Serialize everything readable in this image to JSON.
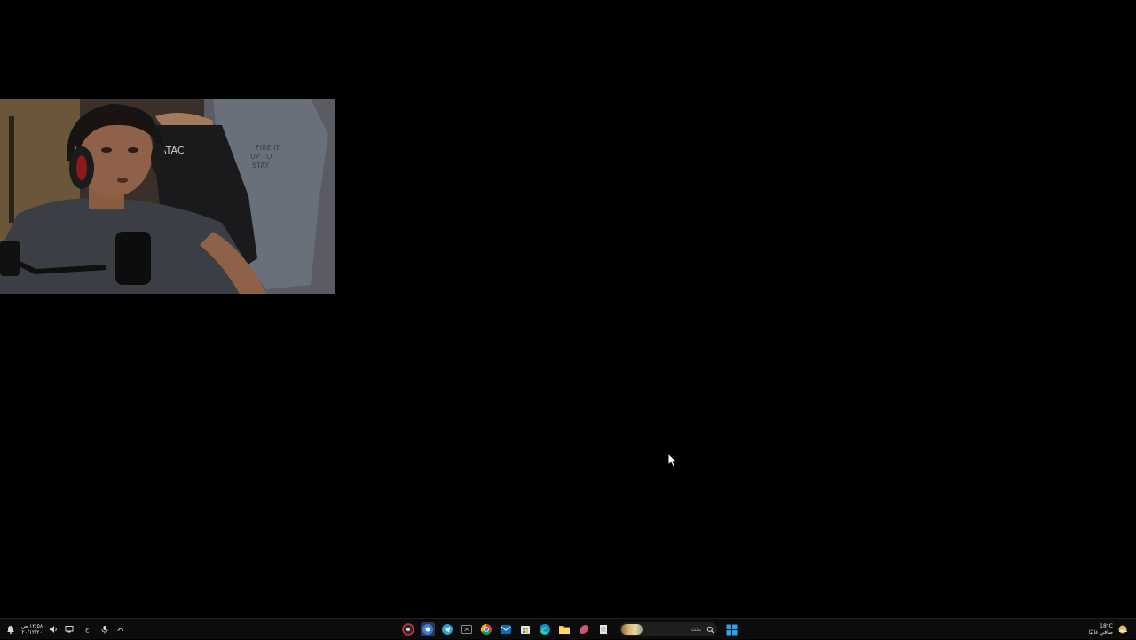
{
  "desktop": {
    "background": "#000000"
  },
  "webcam": {
    "shirt_text": "ATAC"
  },
  "taskbar": {
    "clock": {
      "time": "١٢:٥٨ ص",
      "date": "٢٠/١٢/٢٠"
    },
    "language": "ع",
    "tray_icons": [
      "notification-bell-icon",
      "volume-icon",
      "network-icon",
      "microphone-icon",
      "chevron-up-icon"
    ],
    "apps": [
      "red-app-icon",
      "chrome-profile-icon",
      "telegram-icon",
      "xbox-app-icon",
      "chrome-icon",
      "outlook-icon",
      "microsoft-store-icon",
      "edge-icon",
      "file-explorer-icon",
      "copilot-icon",
      "notepad-icon"
    ],
    "search": {
      "placeholder": "بحث"
    },
    "weather": {
      "temp": "18°C",
      "condition": "صافي غالبًا"
    },
    "colors": {
      "taskbar_bg": "#0c0c0c",
      "accent_blue": "#0078d4"
    }
  }
}
